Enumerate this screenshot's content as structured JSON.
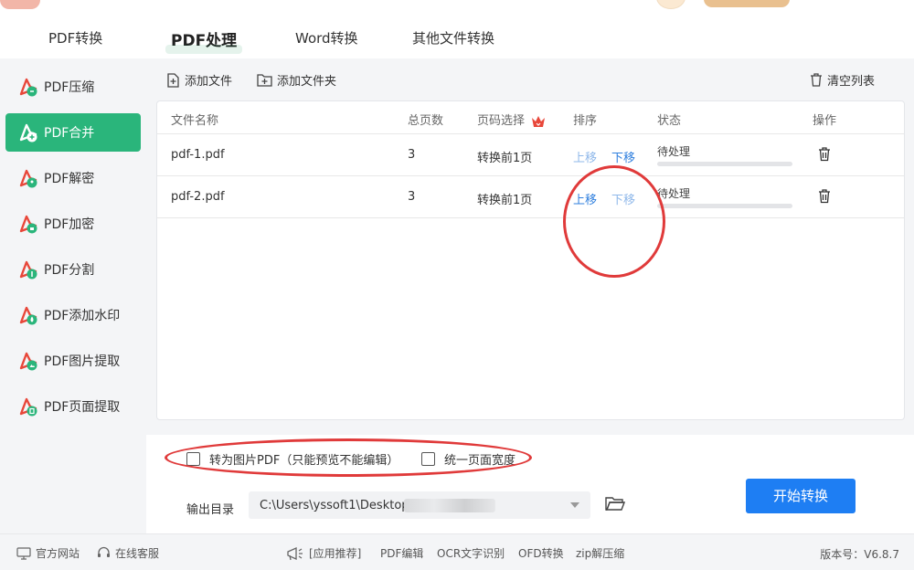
{
  "window": {
    "tabs": [
      {
        "label": "PDF转换",
        "active": false
      },
      {
        "label": "PDF处理",
        "active": true
      },
      {
        "label": "Word转换",
        "active": false
      },
      {
        "label": "其他文件转换",
        "active": false
      }
    ]
  },
  "sidebar": {
    "items": [
      {
        "label": "PDF压缩",
        "icon": "pdf-compress-icon",
        "active": false
      },
      {
        "label": "PDF合并",
        "icon": "pdf-merge-icon",
        "active": true
      },
      {
        "label": "PDF解密",
        "icon": "pdf-decrypt-icon",
        "active": false
      },
      {
        "label": "PDF加密",
        "icon": "pdf-encrypt-icon",
        "active": false
      },
      {
        "label": "PDF分割",
        "icon": "pdf-split-icon",
        "active": false
      },
      {
        "label": "PDF添加水印",
        "icon": "pdf-watermark-icon",
        "active": false
      },
      {
        "label": "PDF图片提取",
        "icon": "pdf-image-extract-icon",
        "active": false
      },
      {
        "label": "PDF页面提取",
        "icon": "pdf-page-extract-icon",
        "active": false
      }
    ]
  },
  "toolbar": {
    "add_file": "添加文件",
    "add_folder": "添加文件夹",
    "clear_list": "清空列表"
  },
  "table": {
    "headers": {
      "name": "文件名称",
      "pages": "总页数",
      "page_select": "页码选择",
      "order": "排序",
      "status": "状态",
      "action": "操作"
    },
    "rows": [
      {
        "name": "pdf-1.pdf",
        "pages": "3",
        "page_select": "转换前1页",
        "up": "上移",
        "down": "下移",
        "status": "待处理",
        "progress": 0
      },
      {
        "name": "pdf-2.pdf",
        "pages": "3",
        "page_select": "转换前1页",
        "up": "上移",
        "down": "下移",
        "status": "待处理",
        "progress": 0
      }
    ]
  },
  "options": {
    "to_image_pdf": "转为图片PDF（只能预览不能编辑）",
    "to_image_pdf_checked": false,
    "uniform_width": "统一页面宽度",
    "uniform_width_checked": false
  },
  "output": {
    "label": "输出目录",
    "path": "C:\\Users\\yssoft1\\Desktop"
  },
  "start_button": "开始转换",
  "statusbar": {
    "website": "官方网站",
    "support": "在线客服",
    "recommend": "[应用推荐]",
    "links": [
      "PDF编辑",
      "OCR文字识别",
      "OFD转换",
      "zip解压缩"
    ],
    "version": "版本号：V6.8.7"
  },
  "colors": {
    "accent_green": "#2ab57b",
    "primary_blue": "#1e7ef3",
    "link_blue": "#2f7fde",
    "pdf_red": "#e8473a",
    "annotation_red": "#e03a3a"
  }
}
